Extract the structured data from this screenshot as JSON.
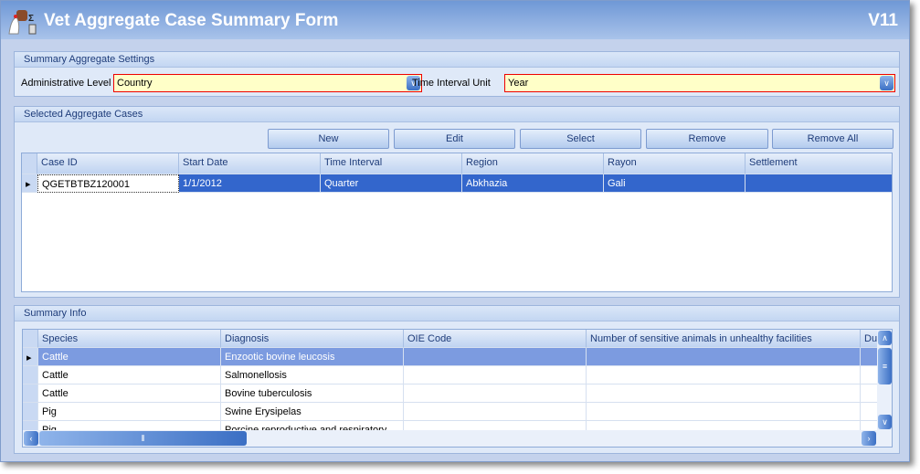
{
  "window": {
    "title": "Vet Aggregate Case Summary Form",
    "version": "V11"
  },
  "settings": {
    "header": "Summary Aggregate Settings",
    "admin_level_label": "Administrative Level",
    "admin_level_value": "Country",
    "time_unit_label": "Time Interval Unit",
    "time_unit_value": "Year"
  },
  "cases": {
    "header": "Selected Aggregate Cases",
    "buttons": {
      "new": "New",
      "edit": "Edit",
      "select": "Select",
      "remove": "Remove",
      "remove_all": "Remove All"
    },
    "columns": [
      "Case ID",
      "Start Date",
      "Time Interval",
      "Region",
      "Rayon",
      "Settlement"
    ],
    "rows": [
      [
        "QGETBTBZ120001",
        "1/1/2012",
        "Quarter",
        "Abkhazia",
        "Gali",
        ""
      ]
    ]
  },
  "summary": {
    "header": "Summary Info",
    "columns": [
      "Species",
      "Diagnosis",
      "OIE Code",
      "Number of sensitive animals in unhealthy facilities",
      "Du"
    ],
    "rows": [
      [
        "Cattle",
        "Enzootic bovine leucosis",
        "",
        "",
        ""
      ],
      [
        "Cattle",
        "Salmonellosis",
        "",
        "",
        ""
      ],
      [
        "Cattle",
        "Bovine tuberculosis",
        "",
        "",
        ""
      ],
      [
        "Pig",
        "Swine Erysipelas",
        "",
        "",
        ""
      ],
      [
        "Pig",
        "Porcine reproductive and respiratory",
        "",
        "",
        ""
      ]
    ]
  },
  "colors": {
    "selected_row": "#3366cc",
    "required_border": "#ee0000",
    "field_bg": "#ffffc8"
  }
}
